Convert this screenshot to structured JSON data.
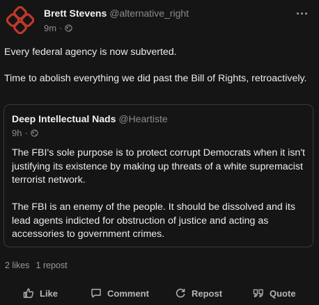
{
  "post": {
    "author_name": "Brett Stevens",
    "author_handle": "@alternative_right",
    "time": "9m",
    "separator": "·",
    "paragraphs": [
      "Every federal agency is now subverted.",
      "Time to abolish everything we did past the Bill of Rights, retroactively."
    ]
  },
  "quote": {
    "author_name": "Deep Intellectual Nads",
    "author_handle": "@Heartiste",
    "time": "9h",
    "separator": "·",
    "paragraphs": [
      "The FBI's sole purpose is to protect corrupt Democrats when it isn't justifying its existence by making up threats of a white supremacist terrorist network.",
      "The FBI is an enemy of the people. It should be dissolved and its lead agents indicted for obstruction of justice and acting as accessories to government crimes."
    ]
  },
  "stats": {
    "likes": "2 likes",
    "reposts": "1 repost"
  },
  "actions": {
    "like": "Like",
    "comment": "Comment",
    "repost": "Repost",
    "quote": "Quote"
  },
  "colors": {
    "background": "#151515",
    "avatar_accent": "#c0392b",
    "muted_text": "#8c8c8c",
    "border": "#3a3a3a"
  },
  "icons": [
    "avatar-logo-icon",
    "globe-icon",
    "more-icon",
    "like-icon",
    "comment-icon",
    "repost-icon",
    "quote-icon"
  ]
}
